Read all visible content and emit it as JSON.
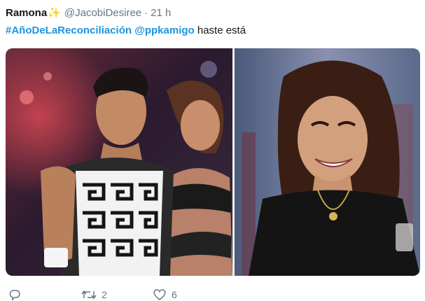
{
  "tweet": {
    "author_name": "Ramona",
    "author_emoji": "✨",
    "handle": "@JacobiDesiree",
    "separator": "·",
    "time": "21 h",
    "hashtag": "#AñoDeLaReconciliación",
    "mention": "@ppkamigo",
    "text": " haste está"
  },
  "actions": {
    "retweet_count": "2",
    "like_count": "6"
  },
  "colors": {
    "link": "#1b95e0",
    "muted": "#657786",
    "text": "#14171a"
  }
}
